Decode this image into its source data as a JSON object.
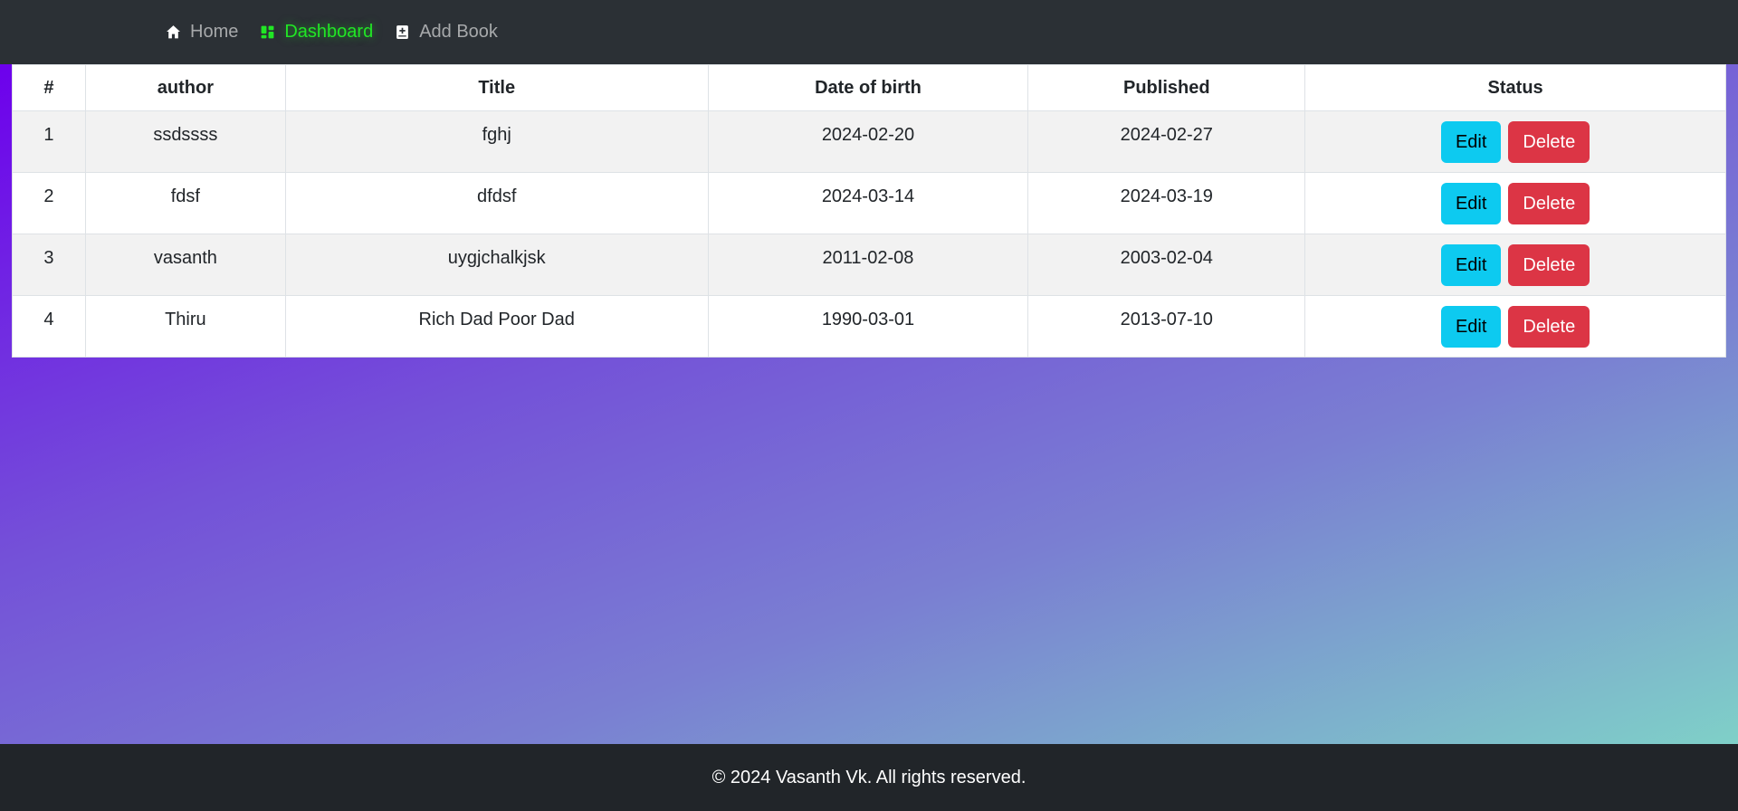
{
  "nav": {
    "items": [
      {
        "label": "Home",
        "icon": "home-icon",
        "active": false
      },
      {
        "label": "Dashboard",
        "icon": "dashboard-icon",
        "active": true
      },
      {
        "label": "Add Book",
        "icon": "add-book-icon",
        "active": false
      }
    ]
  },
  "table": {
    "headers": [
      "#",
      "author",
      "Title",
      "Date of birth",
      "Published",
      "Status"
    ],
    "rows": [
      {
        "num": "1",
        "author": "ssdssss",
        "title": "fghj",
        "dob": "2024-02-20",
        "published": "2024-02-27"
      },
      {
        "num": "2",
        "author": "fdsf",
        "title": "dfdsf",
        "dob": "2024-03-14",
        "published": "2024-03-19"
      },
      {
        "num": "3",
        "author": "vasanth",
        "title": "uygjchalkjsk",
        "dob": "2011-02-08",
        "published": "2003-02-04"
      },
      {
        "num": "4",
        "author": "Thiru",
        "title": "Rich Dad Poor Dad",
        "dob": "1990-03-01",
        "published": "2013-07-10"
      }
    ],
    "edit_label": "Edit",
    "delete_label": "Delete"
  },
  "footer": {
    "text": "© 2024 Vasanth Vk. All rights reserved."
  },
  "colors": {
    "navbar_bg": "#2b3035",
    "active_link": "#21e625",
    "edit_button": "#0dcaf0",
    "delete_button": "#dc3545",
    "footer_bg": "#212529"
  }
}
